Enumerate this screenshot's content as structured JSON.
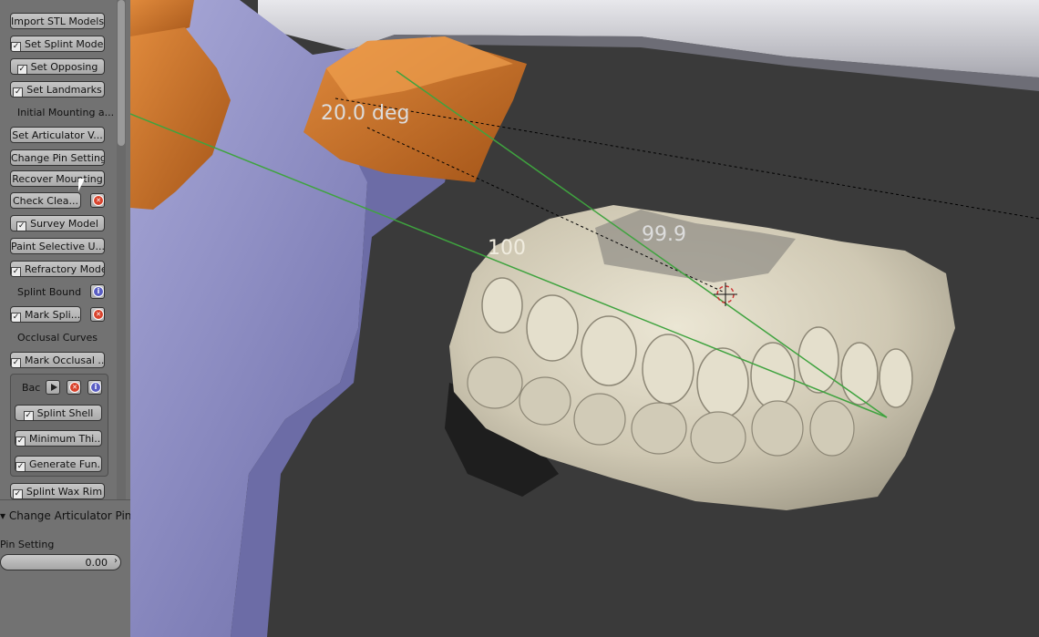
{
  "panel": {
    "buttons": {
      "import_stl": "Import STL Models",
      "set_splint": "Set Splint Model",
      "set_opposing": "Set Opposing",
      "set_landmarks": "Set Landmarks",
      "initial_mounting": "Initial Mounting a...",
      "set_articulator": "Set Articulator V...",
      "change_pin": "Change Pin Setting",
      "recover_mounting": "Recover Mounting",
      "check_clearance": "Check Clea...",
      "survey_model": "Survey Model",
      "paint_selective": "Paint Selective U...",
      "refractory_model": "Refractory Model",
      "splint_bound": "Splint Bound",
      "mark_splint": "Mark Spli...",
      "occlusal_curves": "Occlusal Curves",
      "mark_occlusal": "Mark Occlusal ...",
      "bac": "Bac",
      "splint_shell": "Splint Shell",
      "minimum_thickness": "Minimum Thi...",
      "generate_fun": "Generate Fun...",
      "splint_wax_rim": "Splint Wax Rim"
    },
    "section": {
      "title": "Change Articulator Pin",
      "pin_label": "Pin Setting",
      "pin_value": "0.00"
    }
  },
  "viewport": {
    "angle_label": "20.0 deg",
    "measure_1": "99.9",
    "measure_2": "100"
  },
  "colors": {
    "panel_bg": "#727272",
    "viewport_bg": "#3a3a3a",
    "articulator_purple": "#8f8fc0",
    "articulator_orange": "#c86a22",
    "teeth": "#d8d2bf",
    "guide_line": "#3fa33f"
  }
}
